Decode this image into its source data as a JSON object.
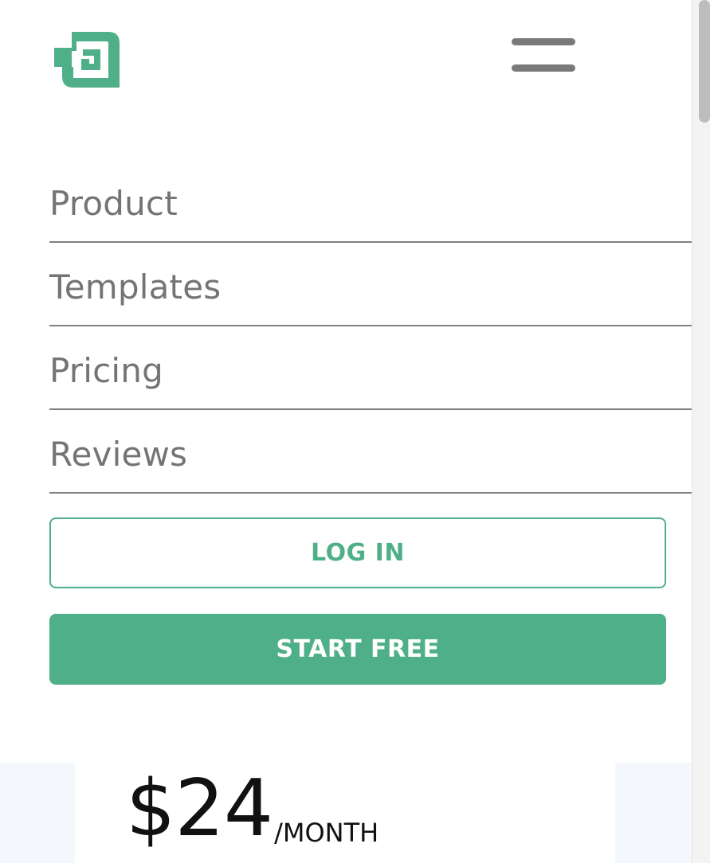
{
  "header": {
    "logo_icon": "brand-logo-icon",
    "menu_icon": "hamburger-menu-icon"
  },
  "nav": {
    "items": [
      {
        "label": "Product"
      },
      {
        "label": "Templates"
      },
      {
        "label": "Pricing"
      },
      {
        "label": "Reviews"
      }
    ]
  },
  "actions": {
    "login_label": "LOG IN",
    "start_label": "START FREE"
  },
  "pricing": {
    "amount": "$24",
    "period": "/MONTH"
  },
  "colors": {
    "brand": "#4faf89",
    "nav_text": "#747474",
    "divider": "#808080",
    "price_text": "#111111",
    "band_background": "#f4f7fb"
  }
}
